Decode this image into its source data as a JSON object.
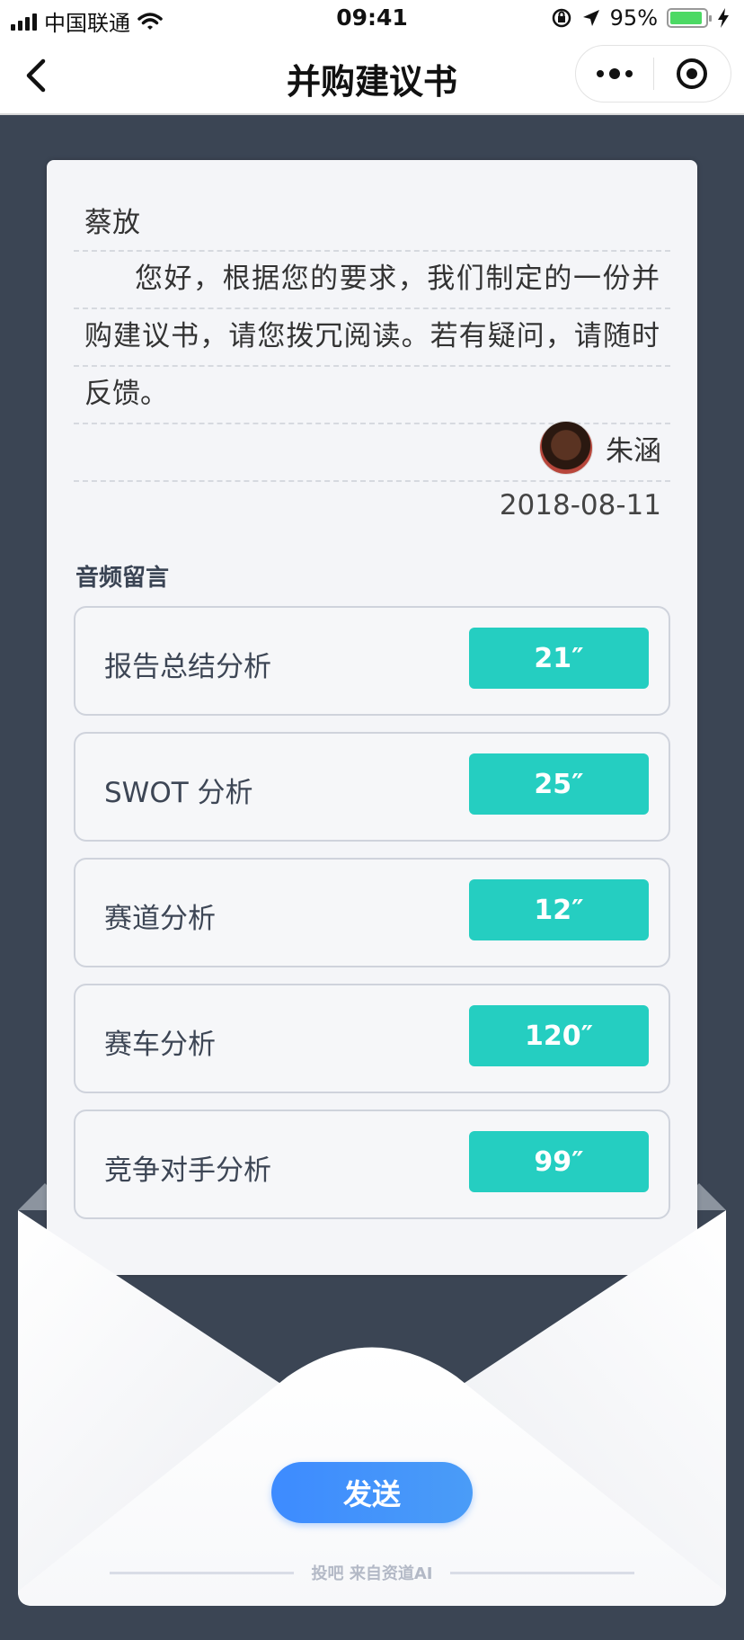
{
  "status_bar": {
    "carrier": "中国联通",
    "time": "09:41",
    "battery": "95%",
    "battery_level": 0.95
  },
  "nav": {
    "title": "并购建议书",
    "back_icon": "chevron-left-icon",
    "more_icon": "more-dots-icon",
    "close_icon": "target-icon"
  },
  "letter": {
    "recipient": "蔡放",
    "body": "您好，根据您的要求，我们制定的一份并购建议书，请您拨冗阅读。若有疑问，请随时反馈。",
    "sender": "朱涵",
    "date": "2018-08-11"
  },
  "audio": {
    "section_title": "音频留言",
    "items": [
      {
        "label": "报告总结分析",
        "duration": "21″"
      },
      {
        "label": "SWOT 分析",
        "duration": "25″"
      },
      {
        "label": "赛道分析",
        "duration": "12″"
      },
      {
        "label": "赛车分析",
        "duration": "120″"
      },
      {
        "label": "竞争对手分析",
        "duration": "99″"
      }
    ]
  },
  "actions": {
    "send_label": "发送"
  },
  "footer": {
    "text": "投吧 来自资道AI"
  },
  "colors": {
    "background": "#3b4554",
    "accent": "#25cec1",
    "primary": "#3d8bff"
  }
}
